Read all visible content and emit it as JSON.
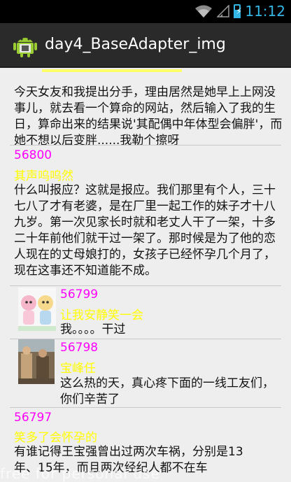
{
  "status_bar": {
    "time": "11:12",
    "wifi_icon": "wifi-icon",
    "signal_icon": "signal-icon",
    "battery_icon": "battery-charging-icon"
  },
  "action_bar": {
    "title": "day4_BaseAdapter_img",
    "icon": "android-icon"
  },
  "items": [
    {
      "body": "今天女友和我提出分手，理由居然是她早上上网没事儿，就去看一个算命的网站，然后输入了我的生日，算命出来的结果说'其配偶中年体型会偏胖'，而她不想以后变胖......我勒个擦呀"
    },
    {
      "id": "56800",
      "title": "其声呜呜然",
      "body": "什么叫报应？这就是报应。我们那里有个人，三十七八了才有老婆，是在厂里一起工作的妹子才十八九岁。第一次见家长时就和老丈人干了一架，十多二十年前他们就干过一架了。那时候是为了他的恋人现在的丈母娘打的，女孩子已经怀孕几个月了，现在这事还不知道能不成。"
    },
    {
      "id": "56799",
      "title": "让我安静笑一会",
      "body": "我。。。。干过",
      "thumb": "cartoon-thumbnail"
    },
    {
      "id": "56798",
      "title": "宝峰任",
      "body": "这么热的天，真心疼下面的一线工友们，你们辛苦了",
      "thumb": "workers-photo-thumbnail"
    },
    {
      "id": "56797",
      "title": "笑多了会怀孕的",
      "body": "有谁记得王宝强曾出过两次车祸，分别是13年、15年，而且两次经纪人都不在车"
    }
  ],
  "watermark": "free for personal use"
}
